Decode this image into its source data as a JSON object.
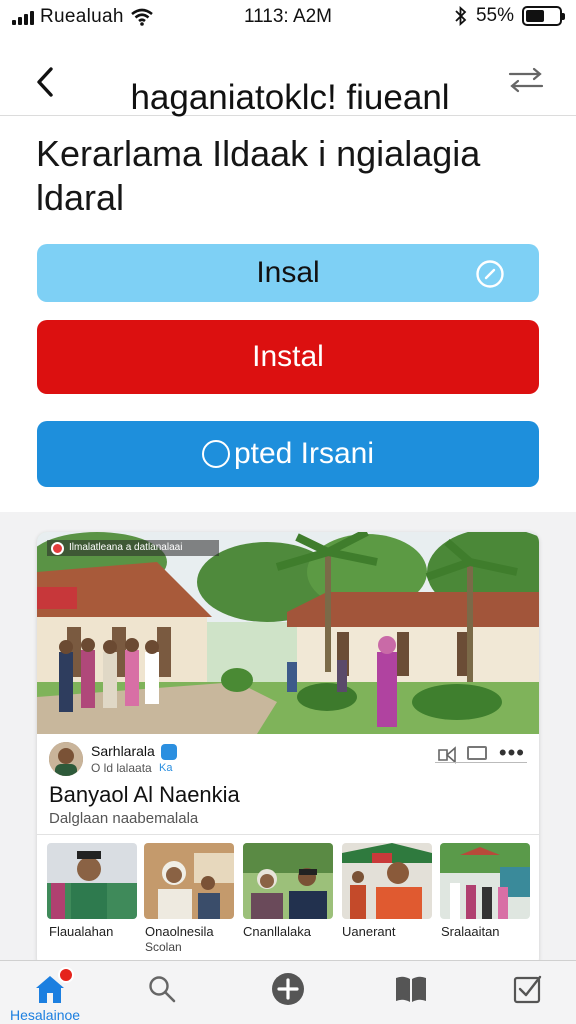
{
  "status_bar": {
    "carrier": "Ruealuah",
    "time": "1113: A2M",
    "battery": "55%",
    "battery_level": 0.55
  },
  "nav": {
    "title": "haganiatoklc! fiueanl"
  },
  "main": {
    "heading": "Kerarlama Ildaak i ngialagia ldaral",
    "buttons": {
      "install_light": "Insal",
      "install_red": "Instal",
      "update": "pted Irsani"
    }
  },
  "card": {
    "hero_caption": "Ilmalatleana a datlanalaai",
    "author_name": "Sarhlarala",
    "author_sub": "O ld lalaata",
    "author_sub_badge": "Ka",
    "title": "Banyaol Al Naenkia",
    "subtitle": "Dalglaan naabemalala",
    "thumbnails": [
      {
        "label": "Flaualahan",
        "sub": ""
      },
      {
        "label": "Onaolnesila",
        "sub": "Scolan"
      },
      {
        "label": "Cnanllalaka",
        "sub": ""
      },
      {
        "label": "Uanerant",
        "sub": ""
      },
      {
        "label": "Sralaaitan",
        "sub": ""
      }
    ]
  },
  "tab_bar": {
    "home_label": "Hesalainoe",
    "icons": [
      "home-icon",
      "search-icon",
      "add-icon",
      "book-icon",
      "checkbox-icon"
    ]
  },
  "colors": {
    "light_blue": "#7ed0f5",
    "red": "#dc1010",
    "blue": "#1e8fdc",
    "accent": "#1c7fe0"
  }
}
